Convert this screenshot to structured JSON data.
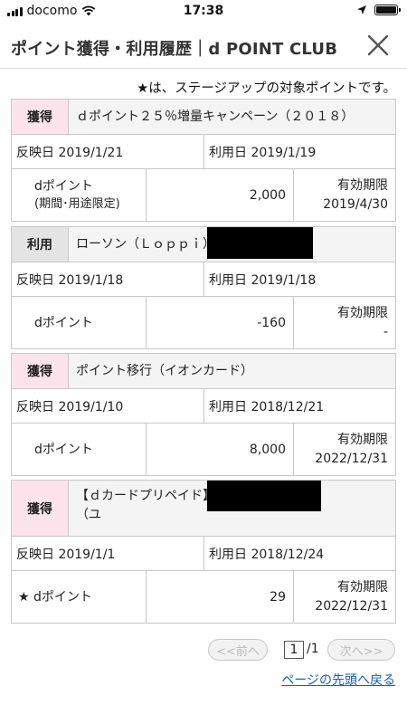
{
  "status_bar": {
    "carrier": "docomo",
    "time": "17:38",
    "icons": [
      "signal-icon",
      "wifi-icon",
      "location-arrow-icon",
      "battery-icon"
    ]
  },
  "header": {
    "title": "ポイント獲得・利用履歴｜d POINT CLUB",
    "close_icon": "close-icon"
  },
  "notice": "★は、ステージアップの対象ポイントです。",
  "records": [
    {
      "type": "獲得",
      "name": "ｄポイント２５％増量キャンペーン（２０１８）",
      "reflect_date": "反映日 2019/1/21",
      "use_date": "利用日 2019/1/19",
      "point_label": "dポイント",
      "point_sublabel": "(期間･用途限定)",
      "points": "2,000",
      "expiry_label": "有効期限",
      "expiry": "2019/4/30"
    },
    {
      "type": "利用",
      "name": "ローソン（Ｌｏｐｐｉ）",
      "reflect_date": "反映日 2019/1/18",
      "use_date": "利用日 2019/1/18",
      "point_label": "dポイント",
      "points": "-160",
      "expiry_label": "有効期限",
      "expiry": "-"
    },
    {
      "type": "獲得",
      "name": "ポイント移行（イオンカード）",
      "reflect_date": "反映日 2019/1/10",
      "use_date": "利用日 2018/12/21",
      "point_label": "dポイント",
      "points": "8,000",
      "expiry_label": "有効期限",
      "expiry": "2022/12/31"
    },
    {
      "type": "獲得",
      "name": "【ｄカードプリペイド】",
      "name_line2": "（ユ",
      "reflect_date": "反映日 2019/1/1",
      "use_date": "利用日 2018/12/24",
      "point_label": "★ dポイント",
      "points": "29",
      "expiry_label": "有効期限",
      "expiry": "2022/12/31"
    }
  ],
  "pagination": {
    "prev": "<<前へ",
    "current": "1",
    "total": "/1",
    "next": "次へ>>"
  },
  "back_to_top": "ページの先頭へ戻る"
}
